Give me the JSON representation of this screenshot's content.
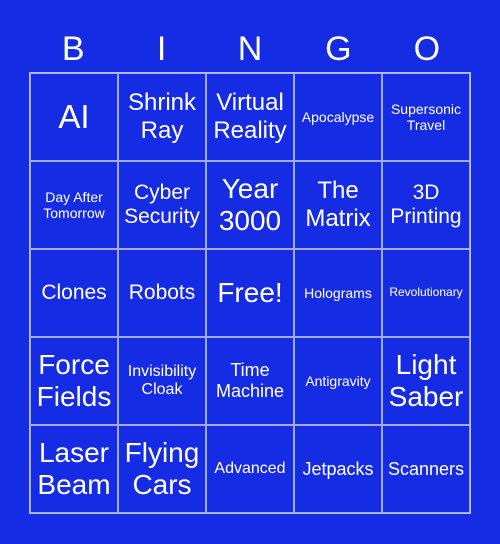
{
  "header": [
    "B",
    "I",
    "N",
    "G",
    "O"
  ],
  "cells": [
    "AI",
    "Shrink Ray",
    "Virtual Reality",
    "Apocalypse",
    "Supersonic Travel",
    "Day After Tomorrow",
    "Cyber Security",
    "Year 3000",
    "The Matrix",
    "3D Printing",
    "Clones",
    "Robots",
    "Free!",
    "Holograms",
    "Revolutionary",
    "Force Fields",
    "Invisibility Cloak",
    "Time Machine",
    "Antigravity",
    "Light Saber",
    "Laser Beam",
    "Flying Cars",
    "Advanced",
    "Jetpacks",
    "Scanners"
  ],
  "colors": {
    "background": "#162ce4",
    "text": "#ffffff"
  }
}
